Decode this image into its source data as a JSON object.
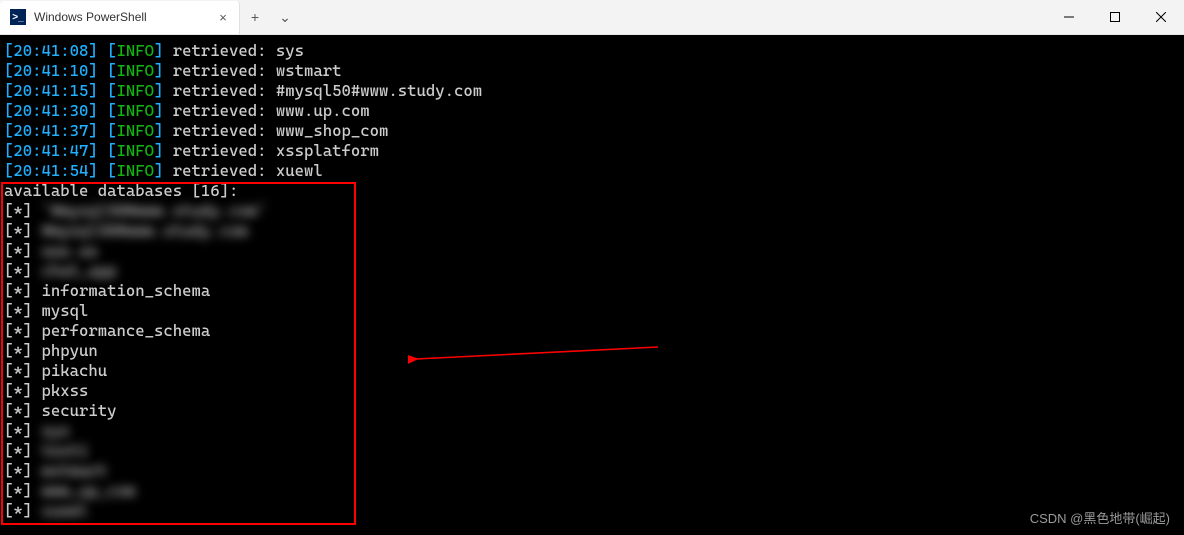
{
  "titlebar": {
    "tab_title": "Windows PowerShell",
    "tab_icon_glyph": ">_",
    "close_glyph": "×",
    "new_tab_glyph": "+",
    "dropdown_glyph": "⌄"
  },
  "window_controls": {
    "minimize": "—",
    "maximize": "▢",
    "close": "×"
  },
  "colors": {
    "timestamp": "#1fb0ff",
    "info": "#10b510",
    "text": "#cccccc",
    "background": "#000000",
    "highlight_box": "#ff0000"
  },
  "log_lines": [
    {
      "time": "20:41:08",
      "level": "INFO",
      "label": "retrieved:",
      "value": "sys"
    },
    {
      "time": "20:41:10",
      "level": "INFO",
      "label": "retrieved:",
      "value": "wstmart"
    },
    {
      "time": "20:41:15",
      "level": "INFO",
      "label": "retrieved:",
      "value": "#mysql50#www.study.com"
    },
    {
      "time": "20:41:30",
      "level": "INFO",
      "label": "retrieved:",
      "value": "www.up.com"
    },
    {
      "time": "20:41:37",
      "level": "INFO",
      "label": "retrieved:",
      "value": "www_shop_com"
    },
    {
      "time": "20:41:47",
      "level": "INFO",
      "label": "retrieved:",
      "value": "xssplatform"
    },
    {
      "time": "20:41:54",
      "level": "INFO",
      "label": "retrieved:",
      "value": "xuewl"
    }
  ],
  "db_header": "available databases [16]:",
  "db_items": [
    {
      "text": "`#mysql50#www.study.com`",
      "blurred": true
    },
    {
      "text": "#mysql50#www.study.com",
      "blurred": true
    },
    {
      "text": "aaa.aa",
      "blurred": true
    },
    {
      "text": "chat_app",
      "blurred": true
    },
    {
      "text": "information_schema",
      "blurred": false
    },
    {
      "text": "mysql",
      "blurred": false
    },
    {
      "text": "performance_schema",
      "blurred": false
    },
    {
      "text": "phpyun",
      "blurred": false
    },
    {
      "text": "pikachu",
      "blurred": false
    },
    {
      "text": "pkxss",
      "blurred": false
    },
    {
      "text": "security",
      "blurred": false
    },
    {
      "text": "sys",
      "blurred": true
    },
    {
      "text": "test1",
      "blurred": true
    },
    {
      "text": "wstmart",
      "blurred": true
    },
    {
      "text": "www_up_com",
      "blurred": true
    },
    {
      "text": "xuewl",
      "blurred": true
    }
  ],
  "bullet": "[*]",
  "watermark": "CSDN @黑色地带(崛起)"
}
